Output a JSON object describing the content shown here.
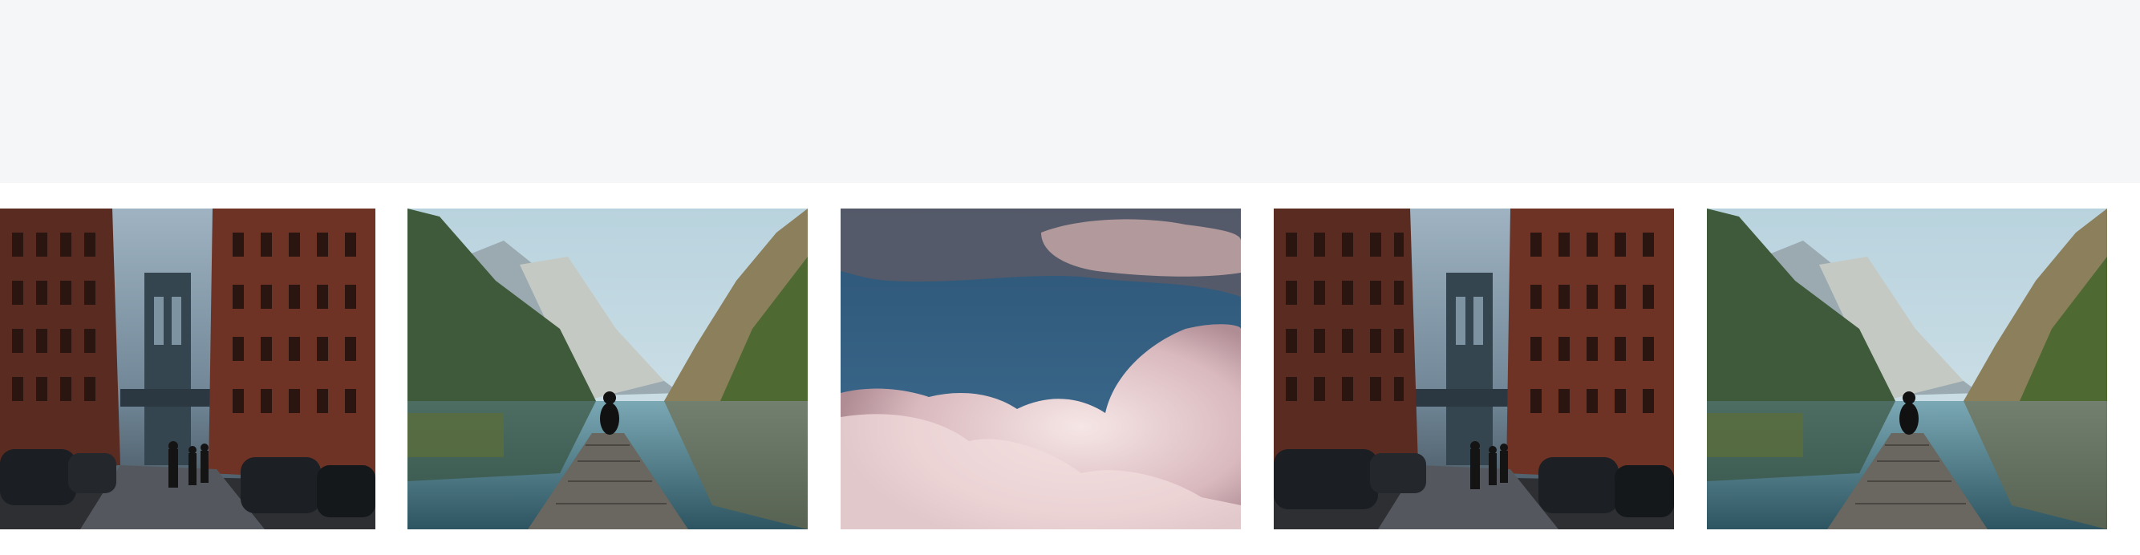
{
  "carousel": {
    "slides": [
      {
        "subject": "city-street-bridge"
      },
      {
        "subject": "mountain-lake-dock"
      },
      {
        "subject": "sky-clouds"
      },
      {
        "subject": "city-street-bridge"
      },
      {
        "subject": "mountain-lake-dock"
      }
    ]
  },
  "colors": {
    "page_background": "#ffffff",
    "top_band": "#f5f6f8"
  }
}
